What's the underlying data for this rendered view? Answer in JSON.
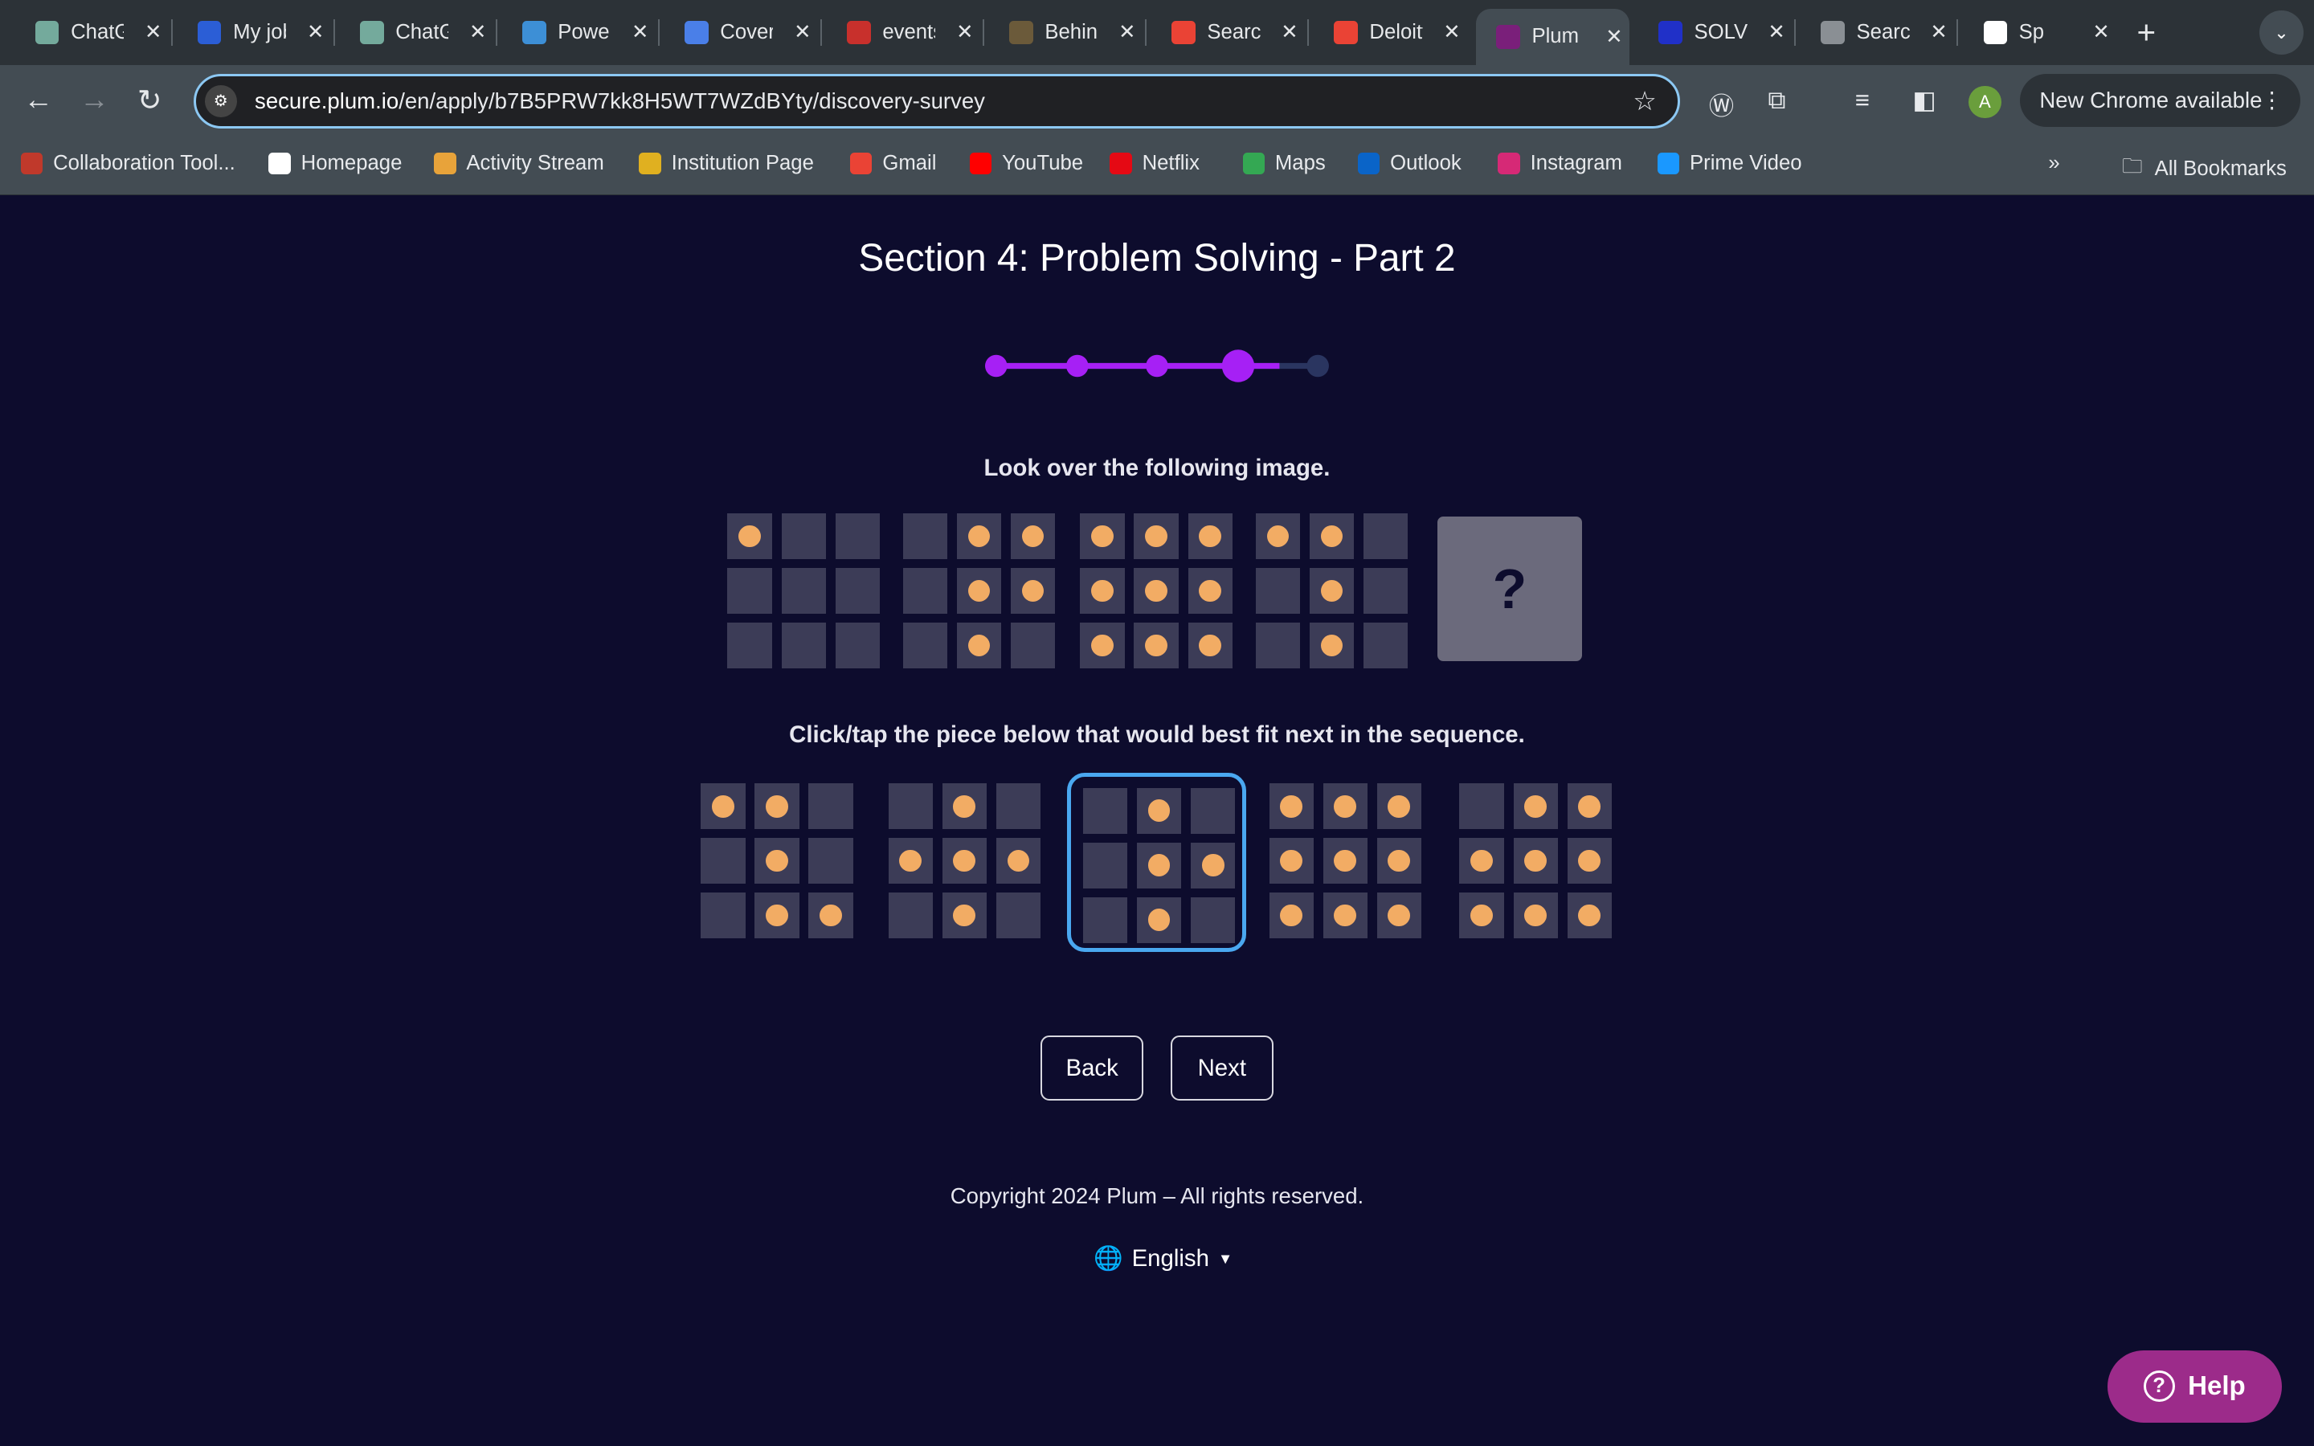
{
  "browser": {
    "tabs": [
      {
        "label": "ChatGPT",
        "color": "#74aa9c"
      },
      {
        "label": "My jobs",
        "color": "#2b5ed6"
      },
      {
        "label": "ChatGPT",
        "color": "#74aa9c"
      },
      {
        "label": "Power",
        "color": "#3d8fd6"
      },
      {
        "label": "Cover",
        "color": "#4a7fe8"
      },
      {
        "label": "events",
        "color": "#c8302c"
      },
      {
        "label": "Behind",
        "color": "#6b5a3a"
      },
      {
        "label": "Search",
        "color": "#ea4335"
      },
      {
        "label": "Deloitte",
        "color": "#ea4335"
      },
      {
        "label": "Plum",
        "color": "#7a1f7a",
        "active": true
      },
      {
        "label": "SOLVE",
        "color": "#2030c8"
      },
      {
        "label": "Search",
        "color": "#8a8f94"
      },
      {
        "label": "Sp",
        "color": "#ffffff"
      }
    ],
    "url_domain": "secure.plum.io",
    "url_path": "/en/apply/b7B5PRW7kk8H5WT7WZdBYty/discovery-survey",
    "new_chrome_label": "New Chrome available",
    "profile_initial": "A",
    "bookmarks": [
      {
        "label": "Collaboration Tool...",
        "color": "#c0392b"
      },
      {
        "label": "Homepage",
        "color": "#ffffff"
      },
      {
        "label": "Activity Stream",
        "color": "#e8a33a"
      },
      {
        "label": "Institution Page",
        "color": "#e0b020"
      },
      {
        "label": "Gmail",
        "color": "#ea4335"
      },
      {
        "label": "YouTube",
        "color": "#ff0000"
      },
      {
        "label": "Netflix",
        "color": "#e50914"
      },
      {
        "label": "Maps",
        "color": "#34a853"
      },
      {
        "label": "Outlook",
        "color": "#0a64c8"
      },
      {
        "label": "Instagram",
        "color": "#d62976"
      },
      {
        "label": "Prime Video",
        "color": "#1a98ff"
      }
    ],
    "all_bookmarks_label": "All Bookmarks"
  },
  "page": {
    "title": "Section 4: Problem Solving - Part 2",
    "progress": {
      "total_steps": 5,
      "current_step": 4,
      "active_color": "#a620f5",
      "inactive_color": "#2a3560"
    },
    "prompt_1": "Look over the following image.",
    "sequence": [
      [
        [
          1,
          0,
          0
        ],
        [
          0,
          0,
          0
        ],
        [
          0,
          0,
          0
        ]
      ],
      [
        [
          0,
          1,
          1
        ],
        [
          0,
          1,
          1
        ],
        [
          0,
          1,
          0
        ]
      ],
      [
        [
          1,
          1,
          1
        ],
        [
          1,
          1,
          1
        ],
        [
          1,
          1,
          1
        ]
      ],
      [
        [
          1,
          1,
          0
        ],
        [
          0,
          1,
          0
        ],
        [
          0,
          1,
          0
        ]
      ]
    ],
    "question_mark": "?",
    "prompt_2": "Click/tap the piece below that would best fit next in the sequence.",
    "options": [
      [
        [
          1,
          1,
          0
        ],
        [
          0,
          1,
          0
        ],
        [
          0,
          1,
          1
        ]
      ],
      [
        [
          0,
          1,
          0
        ],
        [
          1,
          1,
          1
        ],
        [
          0,
          1,
          0
        ]
      ],
      [
        [
          0,
          1,
          0
        ],
        [
          0,
          1,
          1
        ],
        [
          0,
          1,
          0
        ]
      ],
      [
        [
          1,
          1,
          1
        ],
        [
          1,
          1,
          1
        ],
        [
          1,
          1,
          1
        ]
      ],
      [
        [
          0,
          1,
          1
        ],
        [
          1,
          1,
          1
        ],
        [
          1,
          1,
          1
        ]
      ]
    ],
    "selected_option": 3,
    "back_label": "Back",
    "next_label": "Next",
    "copyright": "Copyright 2024 Plum – All rights reserved.",
    "language": "English",
    "help_label": "Help",
    "colors": {
      "background": "#0d0c2d",
      "dot": "#f2ac64",
      "cell": "#3c3c57",
      "selected_border": "#4aa8f0",
      "help": "#9c2b8a"
    }
  }
}
